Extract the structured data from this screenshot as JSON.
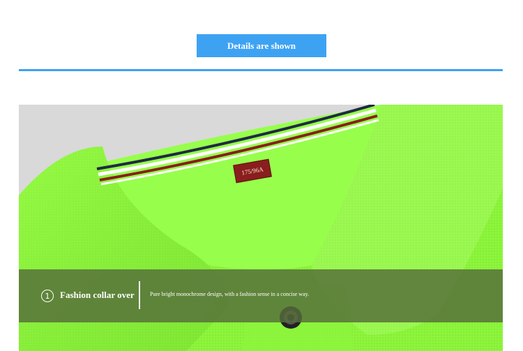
{
  "banner": {
    "label": "Details are shown"
  },
  "product_image": {
    "size_label": "175/96A",
    "caption": {
      "number": "1",
      "title": "Fashion collar over",
      "description": "Pure bright monochrome design, with a fashion sense in a concise way."
    }
  },
  "colors": {
    "accent": "#3ea2f3",
    "garment": "#8cf53c",
    "caption_overlay": "#566c3a",
    "stripe_red": "#8a1e1e",
    "stripe_navy": "#1f2a44"
  }
}
